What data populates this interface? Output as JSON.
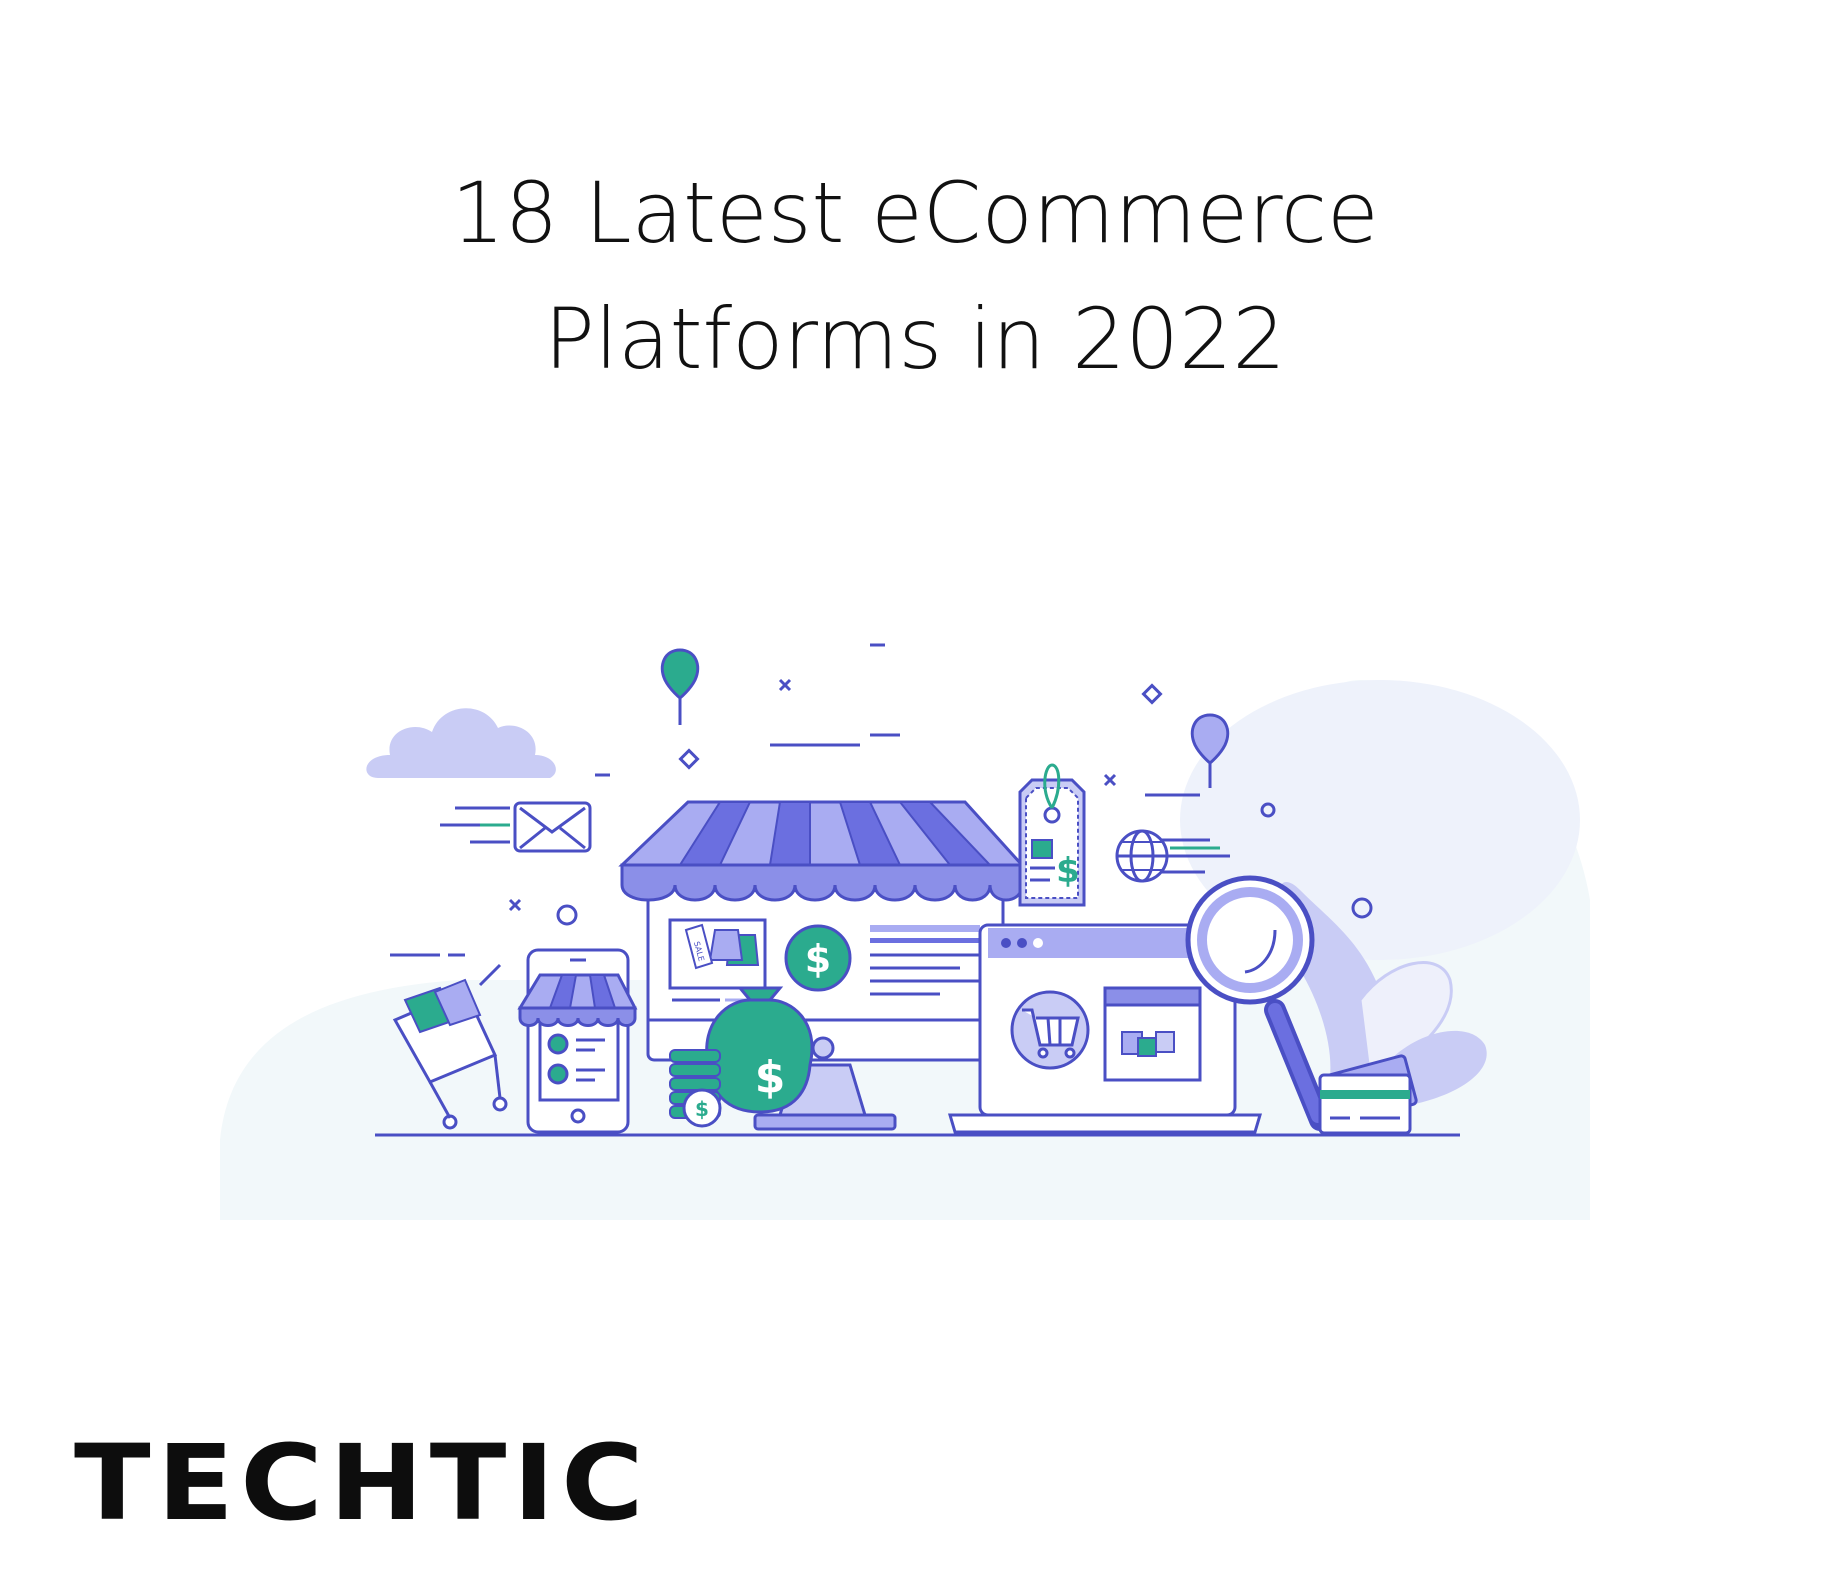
{
  "title": {
    "line1": "18 Latest eCommerce",
    "line2": "Platforms in 2022"
  },
  "illustration": {
    "awning_tag": "SALE"
  },
  "brand": {
    "logo_text": "TECHTIC"
  },
  "colors": {
    "text": "#111111",
    "primary": "#6b6fe0",
    "light_primary": "#c9ccf5",
    "teal": "#2bab8e",
    "background_blob": "#f2f8fa"
  }
}
